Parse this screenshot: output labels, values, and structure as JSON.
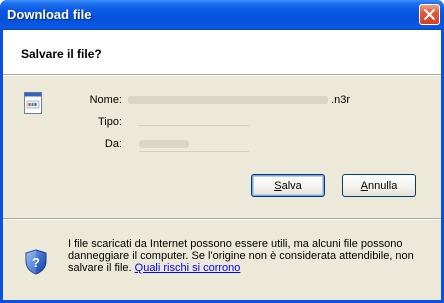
{
  "window": {
    "title": "Download file"
  },
  "header": {
    "title": "Salvare il file?"
  },
  "fields": {
    "name_label": "Nome:",
    "name_suffix": ".n3r",
    "type_label": "Tipo:",
    "from_label": "Da:"
  },
  "buttons": {
    "save_label": "Salva",
    "cancel_label": "Annulla"
  },
  "info": {
    "text": "I file scaricati da Internet possono essere utili, ma alcuni file possono danneggiare il computer. Se l'origine non è considerata attendibile, non salvare il file. ",
    "link": "Quali rischi si corrono"
  },
  "icons": {
    "file": "file-icon",
    "shield": "shield-question-icon",
    "close": "close-icon"
  },
  "colors": {
    "titlebar": "#0a58e3",
    "client": "#ece9d8",
    "close": "#e2583a",
    "link": "#0000ff"
  }
}
